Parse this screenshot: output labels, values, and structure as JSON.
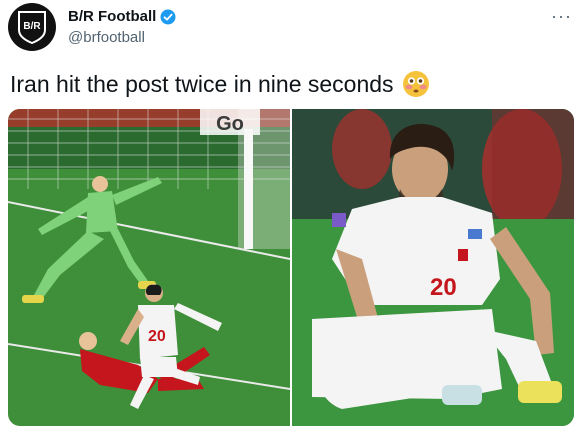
{
  "author": {
    "display_name": "B/R Football",
    "handle": "@brfootball",
    "avatar_text": "B/R",
    "verified": true
  },
  "tweet": {
    "text": "Iran hit the post twice in nine seconds",
    "emoji": "flushed-face"
  },
  "menu": {
    "more_label": "···"
  },
  "media": {
    "left_photo": {
      "shirt_number": "20",
      "board_text": "Go"
    },
    "right_photo": {
      "shirt_number": "20"
    }
  },
  "colors": {
    "pitch": "#3f8f3a",
    "iran_white": "#f4f4f4",
    "wales_red": "#c4161c",
    "keeper_green": "#7fd17a",
    "verified_blue": "#1d9bf0"
  }
}
